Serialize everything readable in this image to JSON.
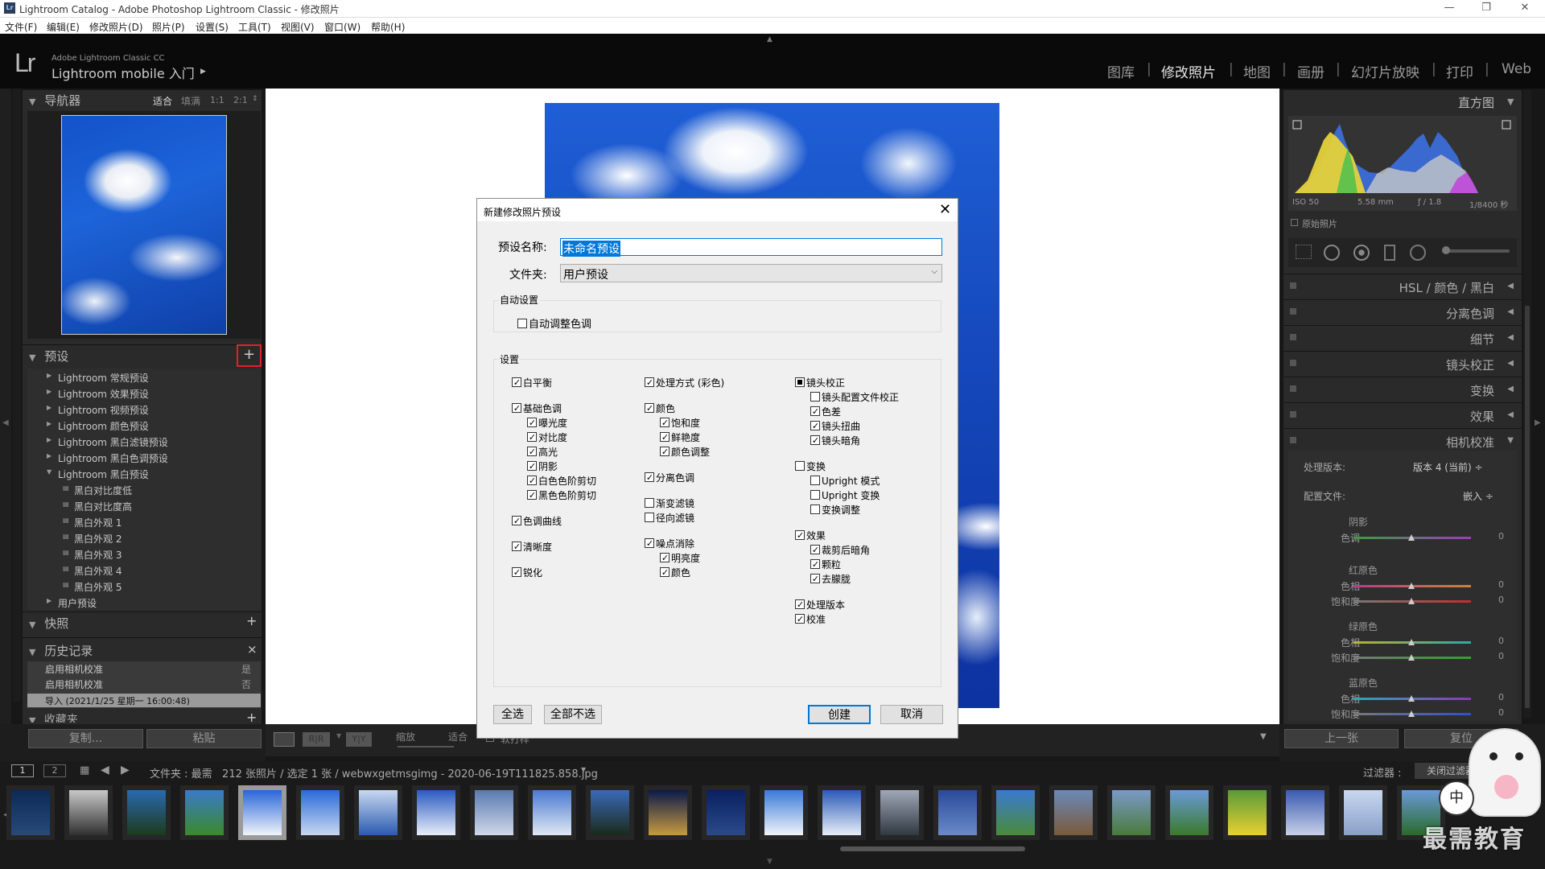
{
  "window": {
    "title": "Lightroom Catalog - Adobe Photoshop Lightroom Classic - 修改照片",
    "min": "—",
    "max": "❐",
    "close": "✕"
  },
  "menu": [
    "文件(F)",
    "编辑(E)",
    "修改照片(D)",
    "照片(P)",
    "设置(S)",
    "工具(T)",
    "视图(V)",
    "窗口(W)",
    "帮助(H)"
  ],
  "identity": {
    "logo": "Lr",
    "small": "Adobe Lightroom Classic CC",
    "big": "Lightroom mobile 入门",
    "arrow": "▶"
  },
  "modules": [
    "图库",
    "修改照片",
    "地图",
    "画册",
    "幻灯片放映",
    "打印",
    "Web"
  ],
  "active_module": "修改照片",
  "left": {
    "navigator": {
      "title": "导航器",
      "zoom": [
        "适合",
        "填满",
        "1:1",
        "2:1"
      ]
    },
    "presets": {
      "title": "预设",
      "add": "+",
      "groups": [
        "Lightroom 常规预设",
        "Lightroom 效果预设",
        "Lightroom 视频预设",
        "Lightroom 颜色预设",
        "Lightroom 黑白滤镜预设",
        "Lightroom 黑白色调预设"
      ],
      "open_group": "Lightroom 黑白预设",
      "items": [
        "黑白对比度低",
        "黑白对比度高",
        "黑白外观 1",
        "黑白外观 2",
        "黑白外观 3",
        "黑白外观 4",
        "黑白外观 5"
      ],
      "user": "用户预设"
    },
    "snapshots": {
      "title": "快照",
      "add": "+"
    },
    "history": {
      "title": "历史记录",
      "close": "×",
      "rows": [
        {
          "label": "启用相机校准",
          "value": "是"
        },
        {
          "label": "启用相机校准",
          "value": "否"
        },
        {
          "label": "导入 (2021/1/25 星期一 16:00:48)",
          "value": ""
        }
      ]
    },
    "collections": {
      "title": "收藏夹",
      "add": "+"
    },
    "copy": "复制...",
    "paste": "粘贴"
  },
  "right": {
    "histogram": {
      "title": "直方图",
      "iso": "ISO 50",
      "focal": "5.58 mm",
      "aperture": "ƒ / 1.8",
      "shutter": "1/8400 秒",
      "original": "原始照片"
    },
    "panels": [
      {
        "label": "HSL / 颜色 / 黑白"
      },
      {
        "label": "分离色调"
      },
      {
        "label": "细节"
      },
      {
        "label": "镜头校正"
      },
      {
        "label": "变换"
      },
      {
        "label": "效果"
      },
      {
        "label": "相机校准"
      }
    ],
    "calibration": {
      "process_label": "处理版本:",
      "process_value": "版本 4 (当前) ÷",
      "profile_label": "配置文件:",
      "profile_value": "嵌入 ÷",
      "groups": [
        {
          "title": "阴影",
          "rows": [
            {
              "label": "色调",
              "value": "0"
            }
          ]
        },
        {
          "title": "红原色",
          "rows": [
            {
              "label": "色相",
              "value": "0"
            },
            {
              "label": "饱和度",
              "value": "0"
            }
          ]
        },
        {
          "title": "绿原色",
          "rows": [
            {
              "label": "色相",
              "value": "0"
            },
            {
              "label": "饱和度",
              "value": "0"
            }
          ]
        },
        {
          "title": "蓝原色",
          "rows": [
            {
              "label": "色相",
              "value": "0"
            },
            {
              "label": "饱和度",
              "value": "0"
            }
          ]
        }
      ]
    },
    "prev": "上一张",
    "reset": "复位"
  },
  "toolbar": {
    "zoom": "缩放",
    "fit": "适合",
    "soft": "软打样"
  },
  "filmstrip": {
    "pages": [
      "1",
      "2"
    ],
    "info": "文件夹 : 最需   212 张照片 / 选定 1 张 / webwxgetmsgimg - 2020-06-19T111825.858.jpg",
    "filter_label": "过滤器 :",
    "filter_value": "关闭过滤器",
    "watermark": "最需教育",
    "mascot_text": "中"
  },
  "dialog": {
    "title": "新建修改照片预设",
    "close": "✕",
    "name_label": "预设名称:",
    "name_value": "未命名预设",
    "folder_label": "文件夹:",
    "folder_value": "用户预设",
    "auto_title": "自动设置",
    "auto_tone": "自动调整色调",
    "settings_title": "设置",
    "col1": [
      {
        "label": "白平衡",
        "state": "on",
        "indent": 0,
        "gap": 0
      },
      {
        "label": "基础色调",
        "state": "on",
        "indent": 0,
        "gap": 1
      },
      {
        "label": "曝光度",
        "state": "on",
        "indent": 1,
        "gap": 0
      },
      {
        "label": "对比度",
        "state": "on",
        "indent": 1,
        "gap": 0
      },
      {
        "label": "高光",
        "state": "on",
        "indent": 1,
        "gap": 0
      },
      {
        "label": "阴影",
        "state": "on",
        "indent": 1,
        "gap": 0
      },
      {
        "label": "白色色阶剪切",
        "state": "on",
        "indent": 1,
        "gap": 0
      },
      {
        "label": "黑色色阶剪切",
        "state": "on",
        "indent": 1,
        "gap": 0
      },
      {
        "label": "色调曲线",
        "state": "on",
        "indent": 0,
        "gap": 1
      },
      {
        "label": "清晰度",
        "state": "on",
        "indent": 0,
        "gap": 1
      },
      {
        "label": "锐化",
        "state": "on",
        "indent": 0,
        "gap": 1
      }
    ],
    "col2": [
      {
        "label": "处理方式 (彩色)",
        "state": "on",
        "indent": 0,
        "gap": 0
      },
      {
        "label": "颜色",
        "state": "on",
        "indent": 0,
        "gap": 1
      },
      {
        "label": "饱和度",
        "state": "on",
        "indent": 1,
        "gap": 0
      },
      {
        "label": "鲜艳度",
        "state": "on",
        "indent": 1,
        "gap": 0
      },
      {
        "label": "颜色调整",
        "state": "on",
        "indent": 1,
        "gap": 0
      },
      {
        "label": "分离色调",
        "state": "on",
        "indent": 0,
        "gap": 1
      },
      {
        "label": "渐变滤镜",
        "state": "off",
        "indent": 0,
        "gap": 1
      },
      {
        "label": "径向滤镜",
        "state": "off",
        "indent": 0,
        "gap": 0
      },
      {
        "label": "噪点消除",
        "state": "on",
        "indent": 0,
        "gap": 1
      },
      {
        "label": "明亮度",
        "state": "on",
        "indent": 1,
        "gap": 0
      },
      {
        "label": "颜色",
        "state": "on",
        "indent": 1,
        "gap": 0
      }
    ],
    "col3": [
      {
        "label": "镜头校正",
        "state": "ind",
        "indent": 0,
        "gap": 0
      },
      {
        "label": "镜头配置文件校正",
        "state": "off",
        "indent": 1,
        "gap": 0
      },
      {
        "label": "色差",
        "state": "on",
        "indent": 1,
        "gap": 0
      },
      {
        "label": "镜头扭曲",
        "state": "on",
        "indent": 1,
        "gap": 0
      },
      {
        "label": "镜头暗角",
        "state": "on",
        "indent": 1,
        "gap": 0
      },
      {
        "label": "变换",
        "state": "off",
        "indent": 0,
        "gap": 1
      },
      {
        "label": "Upright 模式",
        "state": "off",
        "indent": 1,
        "gap": 0
      },
      {
        "label": "Upright 变换",
        "state": "off",
        "indent": 1,
        "gap": 0
      },
      {
        "label": "变换调整",
        "state": "off",
        "indent": 1,
        "gap": 0
      },
      {
        "label": "效果",
        "state": "on",
        "indent": 0,
        "gap": 1
      },
      {
        "label": "裁剪后暗角",
        "state": "on",
        "indent": 1,
        "gap": 0
      },
      {
        "label": "颗粒",
        "state": "on",
        "indent": 1,
        "gap": 0
      },
      {
        "label": "去朦胧",
        "state": "on",
        "indent": 1,
        "gap": 0
      },
      {
        "label": "处理版本",
        "state": "on",
        "indent": 0,
        "gap": 1
      },
      {
        "label": "校准",
        "state": "on",
        "indent": 0,
        "gap": 0
      }
    ],
    "select_all": "全选",
    "select_none": "全部不选",
    "create": "创建",
    "cancel": "取消"
  }
}
